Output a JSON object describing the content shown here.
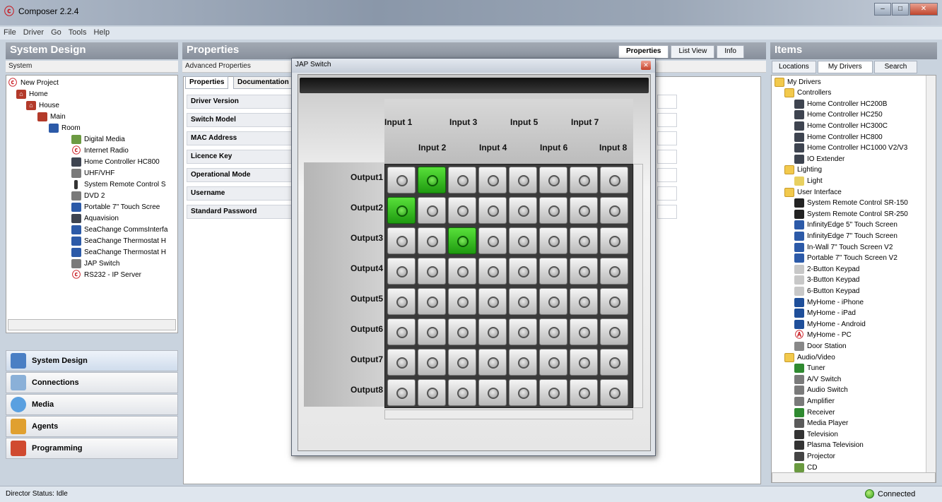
{
  "window": {
    "title": "Composer 2.2.4"
  },
  "menu": [
    "File",
    "Driver",
    "Go",
    "Tools",
    "Help"
  ],
  "left": {
    "header": "System Design",
    "subheader": "System",
    "tree": [
      {
        "label": "New Project",
        "icon": "c4-logo-icon"
      },
      {
        "label": "Home",
        "icon": "home-icon"
      },
      {
        "label": "House",
        "icon": "house-icon"
      },
      {
        "label": "Main",
        "icon": "floor-icon"
      },
      {
        "label": "Room",
        "icon": "room-icon"
      },
      {
        "label": "Digital Media",
        "icon": "digital-media-icon"
      },
      {
        "label": "Internet Radio",
        "icon": "c4-logo-icon"
      },
      {
        "label": "Home Controller HC800",
        "icon": "controller-icon"
      },
      {
        "label": "UHF/VHF",
        "icon": "antenna-icon"
      },
      {
        "label": "System Remote Control S",
        "icon": "remote-icon"
      },
      {
        "label": "DVD 2",
        "icon": "dvd-icon"
      },
      {
        "label": "Portable 7\" Touch Scree",
        "icon": "touchscreen-icon"
      },
      {
        "label": "Aquavision",
        "icon": "tv-icon"
      },
      {
        "label": "SeaChange CommsInterfa",
        "icon": "seachange-icon"
      },
      {
        "label": "SeaChange Thermostat H",
        "icon": "seachange-icon"
      },
      {
        "label": "SeaChange Thermostat H",
        "icon": "seachange-icon"
      },
      {
        "label": "JAP Switch",
        "icon": "switch-icon"
      },
      {
        "label": "RS232 - IP Server",
        "icon": "c4-logo-icon"
      }
    ],
    "nav": [
      {
        "label": "System Design",
        "icon": "system-design-icon"
      },
      {
        "label": "Connections",
        "icon": "connections-icon"
      },
      {
        "label": "Media",
        "icon": "media-icon"
      },
      {
        "label": "Agents",
        "icon": "agents-icon"
      },
      {
        "label": "Programming",
        "icon": "programming-icon"
      }
    ]
  },
  "center": {
    "header": "Properties",
    "subheader": "Advanced Properties",
    "view_tabs": [
      "Properties",
      "List View",
      "Info"
    ],
    "inner_tabs": [
      "Properties",
      "Documentation"
    ],
    "rows": [
      "Driver Version",
      "Switch Model",
      "MAC Address",
      "Licence Key",
      "Operational Mode",
      "Username",
      "Standard Password"
    ]
  },
  "dialog": {
    "title": "JAP Switch",
    "inputs_top": [
      "Input 1",
      "Input 3",
      "Input 5",
      "Input 7"
    ],
    "inputs_bottom": [
      "Input 2",
      "Input 4",
      "Input 6",
      "Input 8"
    ],
    "outputs": [
      "Output1",
      "Output2",
      "Output3",
      "Output4",
      "Output5",
      "Output6",
      "Output7",
      "Output8"
    ],
    "routes": [
      {
        "output": "Output1",
        "input": "Input 2"
      },
      {
        "output": "Output2",
        "input": "Input 1"
      },
      {
        "output": "Output3",
        "input": "Input 3"
      }
    ]
  },
  "right": {
    "header": "Items",
    "tabs": [
      "Locations",
      "My Drivers",
      "Search"
    ],
    "tree": [
      {
        "label": "My Drivers",
        "icon": "folder-icon",
        "level": 0
      },
      {
        "label": "Controllers",
        "icon": "folder-icon",
        "level": 1
      },
      {
        "label": "Home Controller HC200B",
        "icon": "controller-icon",
        "level": 2
      },
      {
        "label": "Home Controller HC250",
        "icon": "controller-icon",
        "level": 2
      },
      {
        "label": "Home Controller HC300C",
        "icon": "controller-icon",
        "level": 2
      },
      {
        "label": "Home Controller HC800",
        "icon": "controller-icon",
        "level": 2
      },
      {
        "label": "Home Controller HC1000 V2/V3",
        "icon": "controller-icon",
        "level": 2
      },
      {
        "label": "IO Extender",
        "icon": "controller-icon",
        "level": 2
      },
      {
        "label": "Lighting",
        "icon": "folder-icon",
        "level": 1
      },
      {
        "label": "Light",
        "icon": "light-icon",
        "level": 2
      },
      {
        "label": "User Interface",
        "icon": "folder-icon",
        "level": 1
      },
      {
        "label": "System Remote Control SR-150",
        "icon": "remote-icon",
        "level": 2
      },
      {
        "label": "System Remote Control SR-250",
        "icon": "remote-icon",
        "level": 2
      },
      {
        "label": "InfinityEdge 5\" Touch Screen",
        "icon": "touchscreen-icon",
        "level": 2
      },
      {
        "label": "InfinityEdge 7\" Touch Screen",
        "icon": "touchscreen-icon",
        "level": 2
      },
      {
        "label": "In-Wall 7\" Touch Screen V2",
        "icon": "touchscreen-icon",
        "level": 2
      },
      {
        "label": "Portable 7\" Touch Screen V2",
        "icon": "touchscreen-icon",
        "level": 2
      },
      {
        "label": "2-Button Keypad",
        "icon": "keypad-icon",
        "level": 2
      },
      {
        "label": "3-Button Keypad",
        "icon": "keypad-icon",
        "level": 2
      },
      {
        "label": "6-Button Keypad",
        "icon": "keypad-icon",
        "level": 2
      },
      {
        "label": "MyHome - iPhone",
        "icon": "myhome-icon",
        "level": 2
      },
      {
        "label": "MyHome - iPad",
        "icon": "myhome-icon",
        "level": 2
      },
      {
        "label": "MyHome - Android",
        "icon": "myhome-icon",
        "level": 2
      },
      {
        "label": "MyHome - PC",
        "icon": "c4-logo-icon",
        "level": 2
      },
      {
        "label": "Door Station",
        "icon": "door-station-icon",
        "level": 2
      },
      {
        "label": "Audio/Video",
        "icon": "folder-icon",
        "level": 1
      },
      {
        "label": "Tuner",
        "icon": "tuner-icon",
        "level": 2
      },
      {
        "label": "A/V Switch",
        "icon": "switch-icon",
        "level": 2
      },
      {
        "label": "Audio Switch",
        "icon": "switch-icon",
        "level": 2
      },
      {
        "label": "Amplifier",
        "icon": "switch-icon",
        "level": 2
      },
      {
        "label": "Receiver",
        "icon": "receiver-icon",
        "level": 2
      },
      {
        "label": "Media Player",
        "icon": "media-player-icon",
        "level": 2
      },
      {
        "label": "Television",
        "icon": "tv-icon",
        "level": 2
      },
      {
        "label": "Plasma Television",
        "icon": "tv-icon",
        "level": 2
      },
      {
        "label": "Projector",
        "icon": "projector-icon",
        "level": 2
      },
      {
        "label": "CD",
        "icon": "cd-icon",
        "level": 2
      }
    ]
  },
  "status": {
    "text": "Director Status: Idle",
    "connection": "Connected"
  },
  "colors": {
    "route_on": "#2fbf1a",
    "panel_header": "#8f97a3",
    "accent": "#c8161d"
  }
}
